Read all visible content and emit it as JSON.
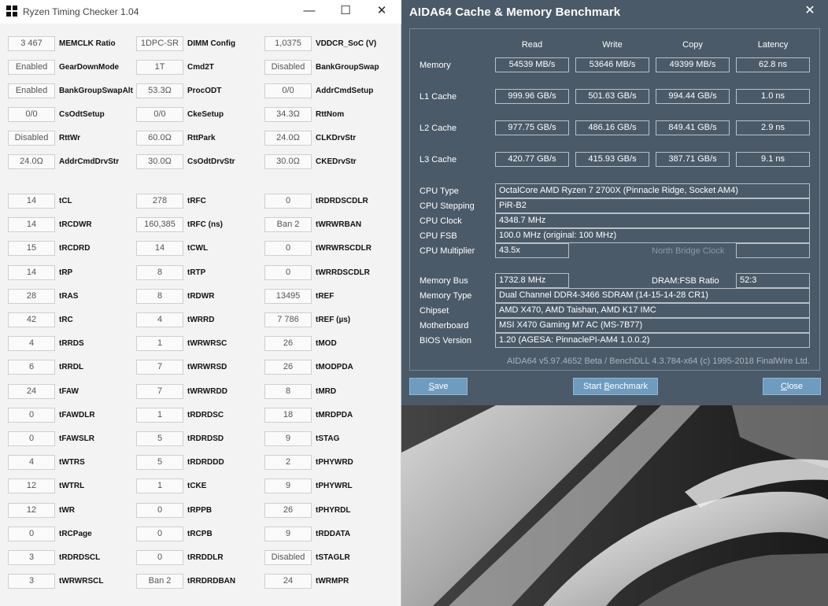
{
  "rtc": {
    "title": "Ryzen Timing Checker 1.04",
    "window_controls": {
      "minimize": "—",
      "maximize": "☐",
      "close": "✕"
    },
    "config_rows": [
      [
        {
          "value": "3 467",
          "label": "MEMCLK Ratio"
        },
        {
          "value": "1DPC-SR",
          "label": "DIMM Config"
        },
        {
          "value": "1,0375",
          "label": "VDDCR_SoC (V)"
        }
      ],
      [
        {
          "value": "Enabled",
          "label": "GearDownMode"
        },
        {
          "value": "1T",
          "label": "Cmd2T"
        },
        {
          "value": "Disabled",
          "label": "BankGroupSwap"
        }
      ],
      [
        {
          "value": "Enabled",
          "label": "BankGroupSwapAlt"
        },
        {
          "value": "53.3Ω",
          "label": "ProcODT"
        },
        {
          "value": "0/0",
          "label": "AddrCmdSetup"
        }
      ],
      [
        {
          "value": "0/0",
          "label": "CsOdtSetup"
        },
        {
          "value": "0/0",
          "label": "CkeSetup"
        },
        {
          "value": "34.3Ω",
          "label": "RttNom"
        }
      ],
      [
        {
          "value": "Disabled",
          "label": "RttWr"
        },
        {
          "value": "60.0Ω",
          "label": "RttPark"
        },
        {
          "value": "24.0Ω",
          "label": "CLKDrvStr"
        }
      ],
      [
        {
          "value": "24.0Ω",
          "label": "AddrCmdDrvStr"
        },
        {
          "value": "30.0Ω",
          "label": "CsOdtDrvStr"
        },
        {
          "value": "30.0Ω",
          "label": "CKEDrvStr"
        }
      ]
    ],
    "timing_rows": [
      [
        {
          "value": "14",
          "label": "tCL"
        },
        {
          "value": "278",
          "label": "tRFC"
        },
        {
          "value": "0",
          "label": "tRDRDSCDLR"
        }
      ],
      [
        {
          "value": "14",
          "label": "tRCDWR"
        },
        {
          "value": "160,385",
          "label": "tRFC (ns)"
        },
        {
          "value": "Ban 2",
          "label": "tWRWRBAN"
        }
      ],
      [
        {
          "value": "15",
          "label": "tRCDRD"
        },
        {
          "value": "14",
          "label": "tCWL"
        },
        {
          "value": "0",
          "label": "tWRWRSCDLR"
        }
      ],
      [
        {
          "value": "14",
          "label": "tRP"
        },
        {
          "value": "8",
          "label": "tRTP"
        },
        {
          "value": "0",
          "label": "tWRRDSCDLR"
        }
      ],
      [
        {
          "value": "28",
          "label": "tRAS"
        },
        {
          "value": "8",
          "label": "tRDWR"
        },
        {
          "value": "13495",
          "label": "tREF"
        }
      ],
      [
        {
          "value": "42",
          "label": "tRC"
        },
        {
          "value": "4",
          "label": "tWRRD"
        },
        {
          "value": "7 786",
          "label": "tREF (µs)"
        }
      ],
      [
        {
          "value": "4",
          "label": "tRRDS"
        },
        {
          "value": "1",
          "label": "tWRWRSC"
        },
        {
          "value": "26",
          "label": "tMOD"
        }
      ],
      [
        {
          "value": "6",
          "label": "tRRDL"
        },
        {
          "value": "7",
          "label": "tWRWRSD"
        },
        {
          "value": "26",
          "label": "tMODPDA"
        }
      ],
      [
        {
          "value": "24",
          "label": "tFAW"
        },
        {
          "value": "7",
          "label": "tWRWRDD"
        },
        {
          "value": "8",
          "label": "tMRD"
        }
      ],
      [
        {
          "value": "0",
          "label": "tFAWDLR"
        },
        {
          "value": "1",
          "label": "tRDRDSC"
        },
        {
          "value": "18",
          "label": "tMRDPDA"
        }
      ],
      [
        {
          "value": "0",
          "label": "tFAWSLR"
        },
        {
          "value": "5",
          "label": "tRDRDSD"
        },
        {
          "value": "9",
          "label": "tSTAG"
        }
      ],
      [
        {
          "value": "4",
          "label": "tWTRS"
        },
        {
          "value": "5",
          "label": "tRDRDDD"
        },
        {
          "value": "2",
          "label": "tPHYWRD"
        }
      ],
      [
        {
          "value": "12",
          "label": "tWTRL"
        },
        {
          "value": "1",
          "label": "tCKE"
        },
        {
          "value": "9",
          "label": "tPHYWRL"
        }
      ],
      [
        {
          "value": "12",
          "label": "tWR"
        },
        {
          "value": "0",
          "label": "tRPPB"
        },
        {
          "value": "26",
          "label": "tPHYRDL"
        }
      ],
      [
        {
          "value": "0",
          "label": "tRCPage"
        },
        {
          "value": "0",
          "label": "tRCPB"
        },
        {
          "value": "9",
          "label": "tRDDATA"
        }
      ],
      [
        {
          "value": "3",
          "label": "tRDRDSCL"
        },
        {
          "value": "0",
          "label": "tRRDDLR"
        },
        {
          "value": "Disabled",
          "label": "tSTAGLR"
        }
      ],
      [
        {
          "value": "3",
          "label": "tWRWRSCL"
        },
        {
          "value": "Ban 2",
          "label": "tRRDRDBAN"
        },
        {
          "value": "24",
          "label": "tWRMPR"
        }
      ]
    ]
  },
  "aida": {
    "title": "AIDA64 Cache & Memory Benchmark",
    "close_glyph": "✕",
    "headers": [
      "Read",
      "Write",
      "Copy",
      "Latency"
    ],
    "bench_rows": [
      {
        "label": "Memory",
        "values": [
          "54539 MB/s",
          "53646 MB/s",
          "49399 MB/s",
          "62.8 ns"
        ]
      },
      {
        "label": "L1 Cache",
        "values": [
          "999.96 GB/s",
          "501.63 GB/s",
          "994.44 GB/s",
          "1.0 ns"
        ]
      },
      {
        "label": "L2 Cache",
        "values": [
          "977.75 GB/s",
          "486.16 GB/s",
          "849.41 GB/s",
          "2.9 ns"
        ]
      },
      {
        "label": "L3 Cache",
        "values": [
          "420.77 GB/s",
          "415.93 GB/s",
          "387.71 GB/s",
          "9.1 ns"
        ]
      }
    ],
    "cpu_type": {
      "label": "CPU Type",
      "value": "OctalCore AMD Ryzen 7 2700X  (Pinnacle Ridge, Socket AM4)"
    },
    "cpu_stepping": {
      "label": "CPU Stepping",
      "value": "PiR-B2"
    },
    "cpu_clock": {
      "label": "CPU Clock",
      "value": "4348.7 MHz"
    },
    "cpu_fsb": {
      "label": "CPU FSB",
      "value": "100.0 MHz  (original: 100 MHz)"
    },
    "cpu_multiplier": {
      "label": "CPU Multiplier",
      "value": "43.5x"
    },
    "nb_clock": {
      "label": "North Bridge Clock",
      "value": ""
    },
    "memory_bus": {
      "label": "Memory Bus",
      "value": "1732.8 MHz"
    },
    "dram_fsb": {
      "label": "DRAM:FSB Ratio",
      "value": "52:3"
    },
    "memory_type": {
      "label": "Memory Type",
      "value": "Dual Channel DDR4-3466 SDRAM  (14-15-14-28 CR1)"
    },
    "chipset": {
      "label": "Chipset",
      "value": "AMD X470, AMD Taishan, AMD K17 IMC"
    },
    "motherboard": {
      "label": "Motherboard",
      "value": "MSI X470 Gaming M7 AC (MS-7B77)"
    },
    "bios": {
      "label": "BIOS Version",
      "value": "1.20  (AGESA: PinnaclePI-AM4 1.0.0.2)"
    },
    "footer": "AIDA64 v5.97.4652 Beta / BenchDLL 4.3.784-x64  (c) 1995-2018 FinalWire Ltd.",
    "buttons": {
      "save": "Save",
      "start": "Start Benchmark",
      "close": "Close"
    }
  },
  "colors": {
    "aida_bg": "#4b5a68",
    "aida_button": "#6f9bbf",
    "rtc_bg": "#f3f3f3",
    "rtc_field_border": "#cfcfcf"
  }
}
